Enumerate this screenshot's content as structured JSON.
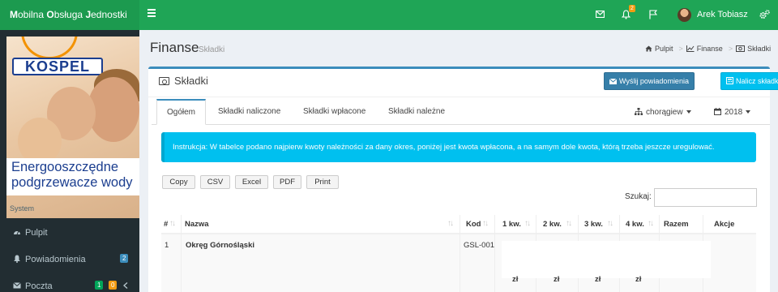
{
  "app": {
    "logo": {
      "w1_initial": "M",
      "w1_rest": "obilna",
      "w2_initial": "O",
      "w2_rest": "bsługa",
      "w3_initial": "J",
      "w3_rest": "ednostki"
    }
  },
  "header": {
    "notifications_badge": "2",
    "user_name": "Arek Tobiasz",
    "icons": [
      "menu-icon",
      "envelope-icon",
      "bell-icon",
      "flag-icon",
      "cogs-icon"
    ]
  },
  "sidebar": {
    "banner": {
      "brand": "KOSPEL",
      "tagline_line1": "Energooszczędne",
      "tagline_line2": "podgrzewacze wody"
    },
    "section_header": "System",
    "items": [
      {
        "label": "Pulpit",
        "icon": "dashboard-icon"
      },
      {
        "label": "Powiadomienia",
        "icon": "bell-icon",
        "badge": "2"
      },
      {
        "label": "Poczta",
        "icon": "envelope-icon",
        "badge_green": "1",
        "badge_orange": "0"
      }
    ]
  },
  "page": {
    "title": "Finanse",
    "subtitle": "Składki",
    "breadcrumb": [
      "Pulpit",
      "Finanse",
      "Składki"
    ]
  },
  "box": {
    "title": "Składki",
    "send_button": "Wyślij powiadomienia",
    "calc_button": "Nalicz składki"
  },
  "tabs": [
    "Ogółem",
    "Składki naliczone",
    "Składki wpłacone",
    "Składki należne"
  ],
  "filters": {
    "unit": "chorągiew",
    "year": "2018"
  },
  "callout": "Instrukcja: W tabelce podano najpierw kwoty należności za dany okres, poniżej jest kwota wpłacona, a na samym dole kwota, którą trzeba jeszcze uregulować.",
  "export_buttons": [
    "Copy",
    "CSV",
    "Excel",
    "PDF",
    "Print"
  ],
  "search": {
    "label": "Szukaj:",
    "value": ""
  },
  "table": {
    "columns": [
      "#",
      "Nazwa",
      "Kod",
      "1 kw.",
      "2 kw.",
      "3 kw.",
      "4 kw.",
      "Razem",
      "Akcje"
    ],
    "rows": [
      {
        "no": "1",
        "name": "Okręg Górnośląski",
        "code": "GSL-001",
        "currency": "zł"
      }
    ]
  },
  "colors": {
    "header_green": "#1fa556",
    "sidebar_dark": "#222d32",
    "primary": "#3c8dbc",
    "info": "#00c0ef"
  }
}
